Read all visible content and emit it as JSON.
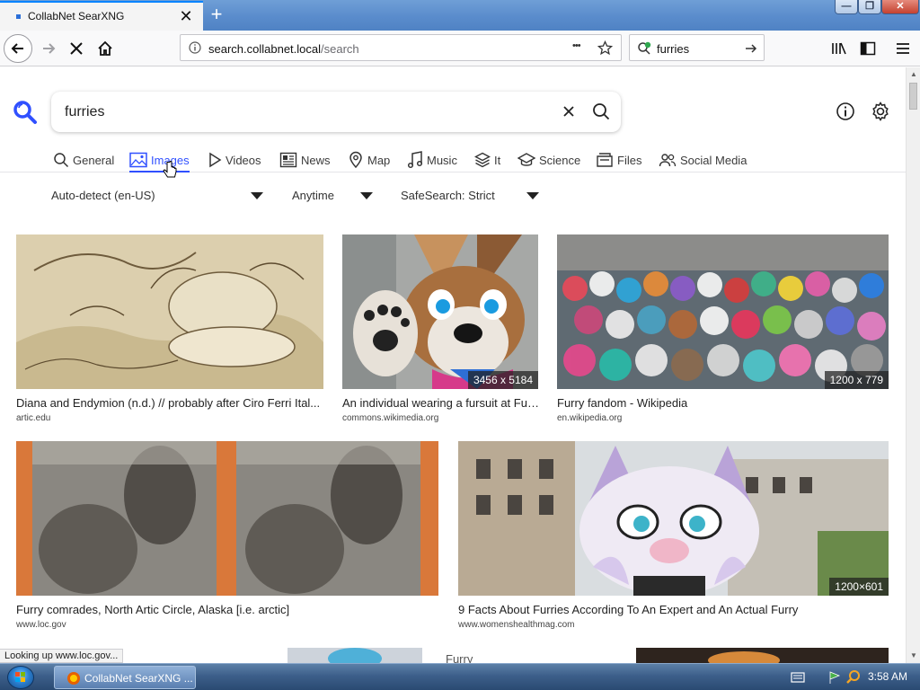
{
  "browser": {
    "tab_title": "CollabNet SearXNG",
    "new_tab": "+",
    "url_domain": "search.collabnet.local",
    "url_path": "/search",
    "url_more": "•••",
    "searchbar_value": "furries"
  },
  "search": {
    "query": "furries"
  },
  "categories": [
    {
      "label": "General",
      "icon": "search-icon"
    },
    {
      "label": "Images",
      "icon": "image-icon"
    },
    {
      "label": "Videos",
      "icon": "play-icon"
    },
    {
      "label": "News",
      "icon": "news-icon"
    },
    {
      "label": "Map",
      "icon": "map-pin-icon"
    },
    {
      "label": "Music",
      "icon": "music-icon"
    },
    {
      "label": "It",
      "icon": "layers-icon"
    },
    {
      "label": "Science",
      "icon": "graduation-cap-icon"
    },
    {
      "label": "Files",
      "icon": "files-icon"
    },
    {
      "label": "Social Media",
      "icon": "people-icon"
    }
  ],
  "active_category": "Images",
  "filters": {
    "language": "Auto-detect (en-US)",
    "time": "Anytime",
    "safesearch": "SafeSearch: Strict"
  },
  "results": [
    {
      "title": "Diana and Endymion (n.d.) // probably after Ciro Ferri Ital...",
      "source": "artic.edu",
      "dims": ""
    },
    {
      "title": "An individual wearing a fursuit at Fur...",
      "source": "commons.wikimedia.org",
      "dims": "3456 x 5184"
    },
    {
      "title": "Furry fandom - Wikipedia",
      "source": "en.wikipedia.org",
      "dims": "1200 x 779"
    },
    {
      "title": "Furry comrades, North Artic Circle, Alaska [i.e. arctic]",
      "source": "www.loc.gov",
      "dims": ""
    },
    {
      "title": "9 Facts About Furries According To An Expert and An Actual Furry",
      "source": "www.womenshealthmag.com",
      "dims": "1200×601"
    },
    {
      "title": "Furry",
      "source": "",
      "dims": ""
    }
  ],
  "status_text": "Looking up www.loc.gov...",
  "taskbar": {
    "task_label": "CollabNet SearXNG ...",
    "clock": "3:58 AM"
  },
  "colors": {
    "accent": "#3050ff",
    "tab_highlight": "#0a84ff"
  }
}
